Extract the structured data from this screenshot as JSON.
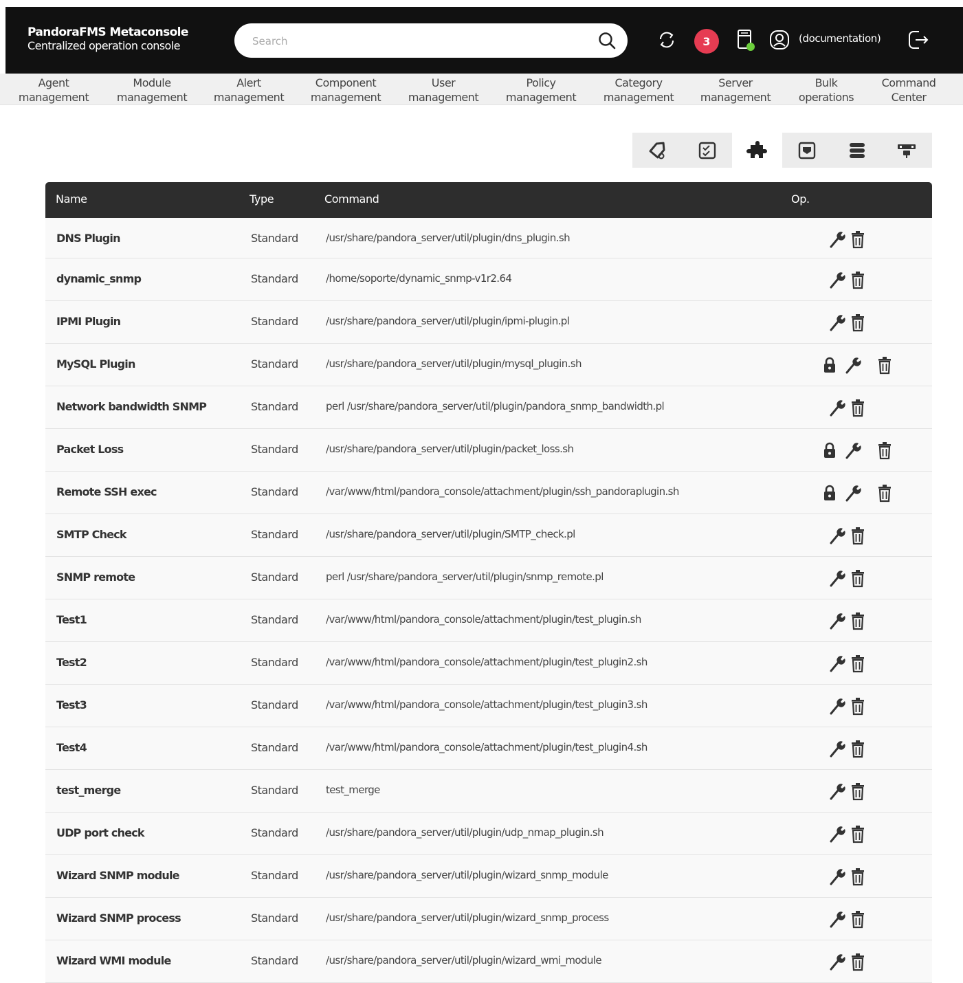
{
  "header": {
    "brand_title": "PandoraFMS Metaconsole",
    "brand_subtitle": "Centralized operation console",
    "search_placeholder": "Search",
    "notification_count": "3",
    "username": "(documentation)",
    "icons": [
      "search-icon",
      "refresh-icon",
      "server-status-icon",
      "user-icon",
      "logout-icon"
    ],
    "badge_color": "#e63c52"
  },
  "nav": [
    {
      "l1": "Agent",
      "l2": "management"
    },
    {
      "l1": "Module",
      "l2": "management"
    },
    {
      "l1": "Alert",
      "l2": "management"
    },
    {
      "l1": "Component",
      "l2": "management"
    },
    {
      "l1": "User",
      "l2": "management"
    },
    {
      "l1": "Policy",
      "l2": "management"
    },
    {
      "l1": "Category",
      "l2": "management"
    },
    {
      "l1": "Server",
      "l2": "management"
    },
    {
      "l1": "Bulk",
      "l2": "operations"
    },
    {
      "l1": "Command",
      "l2": "Center"
    }
  ],
  "tabs": [
    {
      "icon": "tag-icon"
    },
    {
      "icon": "checklist-icon"
    },
    {
      "icon": "plugin-icon",
      "active": true
    },
    {
      "icon": "inventory-icon"
    },
    {
      "icon": "database-icon"
    },
    {
      "icon": "network-icon"
    }
  ],
  "table": {
    "headers": {
      "name": "Name",
      "type": "Type",
      "command": "Command",
      "op": "Op."
    },
    "rows": [
      {
        "name": "DNS Plugin",
        "type": "Standard",
        "command": "/usr/share/pandora_server/util/plugin/dns_plugin.sh",
        "locked": false
      },
      {
        "name": "dynamic_snmp",
        "type": "Standard",
        "command": "/home/soporte/dynamic_snmp-v1r2.64",
        "locked": false
      },
      {
        "name": "IPMI Plugin",
        "type": "Standard",
        "command": "/usr/share/pandora_server/util/plugin/ipmi-plugin.pl",
        "locked": false
      },
      {
        "name": "MySQL Plugin",
        "type": "Standard",
        "command": "/usr/share/pandora_server/util/plugin/mysql_plugin.sh",
        "locked": true
      },
      {
        "name": "Network bandwidth SNMP",
        "type": "Standard",
        "command": "perl /usr/share/pandora_server/util/plugin/pandora_snmp_bandwidth.pl",
        "locked": false
      },
      {
        "name": "Packet Loss",
        "type": "Standard",
        "command": "/usr/share/pandora_server/util/plugin/packet_loss.sh",
        "locked": true
      },
      {
        "name": "Remote SSH exec",
        "type": "Standard",
        "command": "/var/www/html/pandora_console/attachment/plugin/ssh_pandoraplugin.sh",
        "locked": true
      },
      {
        "name": "SMTP Check",
        "type": "Standard",
        "command": "/usr/share/pandora_server/util/plugin/SMTP_check.pl",
        "locked": false
      },
      {
        "name": "SNMP remote",
        "type": "Standard",
        "command": "perl /usr/share/pandora_server/util/plugin/snmp_remote.pl",
        "locked": false
      },
      {
        "name": "Test1",
        "type": "Standard",
        "command": "/var/www/html/pandora_console/attachment/plugin/test_plugin.sh",
        "locked": false
      },
      {
        "name": "Test2",
        "type": "Standard",
        "command": "/var/www/html/pandora_console/attachment/plugin/test_plugin2.sh",
        "locked": false
      },
      {
        "name": "Test3",
        "type": "Standard",
        "command": "/var/www/html/pandora_console/attachment/plugin/test_plugin3.sh",
        "locked": false
      },
      {
        "name": "Test4",
        "type": "Standard",
        "command": "/var/www/html/pandora_console/attachment/plugin/test_plugin4.sh",
        "locked": false
      },
      {
        "name": "test_merge",
        "type": "Standard",
        "command": "test_merge",
        "locked": false
      },
      {
        "name": "UDP port check",
        "type": "Standard",
        "command": "/usr/share/pandora_server/util/plugin/udp_nmap_plugin.sh",
        "locked": false
      },
      {
        "name": "Wizard SNMP module",
        "type": "Standard",
        "command": "/usr/share/pandora_server/util/plugin/wizard_snmp_module",
        "locked": false
      },
      {
        "name": "Wizard SNMP process",
        "type": "Standard",
        "command": "/usr/share/pandora_server/util/plugin/wizard_snmp_process",
        "locked": false
      },
      {
        "name": "Wizard WMI module",
        "type": "Standard",
        "command": "/usr/share/pandora_server/util/plugin/wizard_wmi_module",
        "locked": false
      }
    ]
  }
}
